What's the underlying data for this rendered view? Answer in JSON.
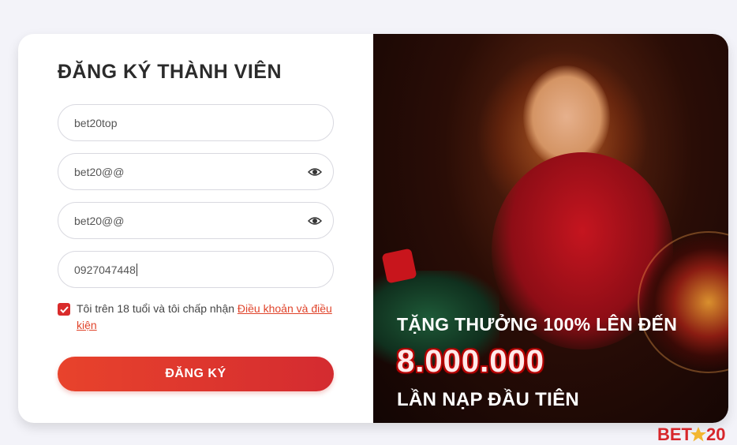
{
  "form": {
    "title": "ĐĂNG KÝ THÀNH VIÊN",
    "username_value": "bet20top",
    "password_value": "bet20@@",
    "confirm_password_value": "bet20@@",
    "phone_value": "0927047448",
    "agree_text": "Tôi trên 18 tuổi và tôi chấp nhận ",
    "terms_link": "Điều khoản và điều kiện",
    "agree_checked": true,
    "submit_label": "ĐĂNG KÝ"
  },
  "promo": {
    "line1": "TẶNG THƯỞNG 100% LÊN ĐẾN",
    "amount": "8.000.000",
    "line3": "LẦN NẠP ĐẦU TIÊN"
  },
  "brand": {
    "logo_text": "BET20",
    "accent_color": "#e0442b"
  },
  "icons": [
    "eye-icon",
    "checkmark-icon",
    "star-icon"
  ]
}
